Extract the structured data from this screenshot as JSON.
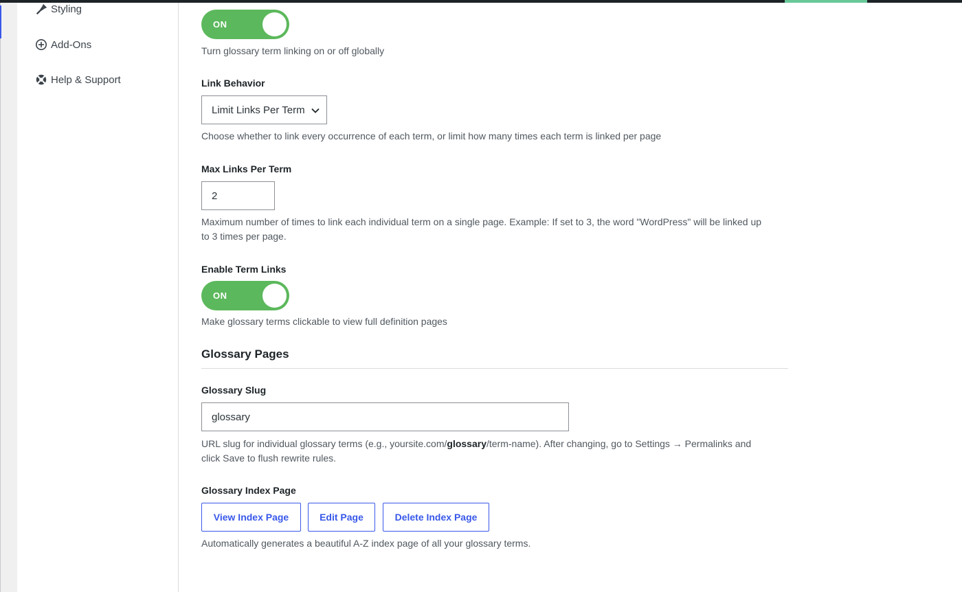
{
  "sidebar": {
    "items": [
      {
        "label": "Styling",
        "icon": "paintbrush-icon"
      },
      {
        "label": "Add-Ons",
        "icon": "plus-circle-icon"
      },
      {
        "label": "Help & Support",
        "icon": "lifebuoy-icon"
      }
    ]
  },
  "settings": {
    "global_toggle": {
      "state": "ON",
      "description": "Turn glossary term linking on or off globally"
    },
    "link_behavior": {
      "label": "Link Behavior",
      "selected": "Limit Links Per Term",
      "description": "Choose whether to link every occurrence of each term, or limit how many times each term is linked per page"
    },
    "max_links": {
      "label": "Max Links Per Term",
      "value": "2",
      "description_line1": "Maximum number of times to link each individual term on a single page. Example: If set to 3, the word \"WordPress\" will be linked up",
      "description_line2": "to 3 times per page."
    },
    "term_links": {
      "label": "Enable Term Links",
      "state": "ON",
      "description": "Make glossary terms clickable to view full definition pages"
    }
  },
  "glossary_pages": {
    "title": "Glossary Pages",
    "slug": {
      "label": "Glossary Slug",
      "value": "glossary",
      "desc_prefix": "URL slug for individual glossary terms (e.g., yoursite.com/",
      "desc_bold": "glossary",
      "desc_suffix": "/term-name). After changing, go to Settings → Permalinks and",
      "desc_line2": "click Save to flush rewrite rules."
    },
    "index_page": {
      "label": "Glossary Index Page",
      "buttons": {
        "view": "View Index Page",
        "edit": "Edit Page",
        "delete": "Delete Index Page"
      },
      "description": "Automatically generates a beautiful A-Z index page of all your glossary terms."
    }
  },
  "colors": {
    "toggle_on": "#5cb85c",
    "accent": "#3858e9",
    "topbar": "#1d2327",
    "topbar_accent": "#68c898"
  }
}
